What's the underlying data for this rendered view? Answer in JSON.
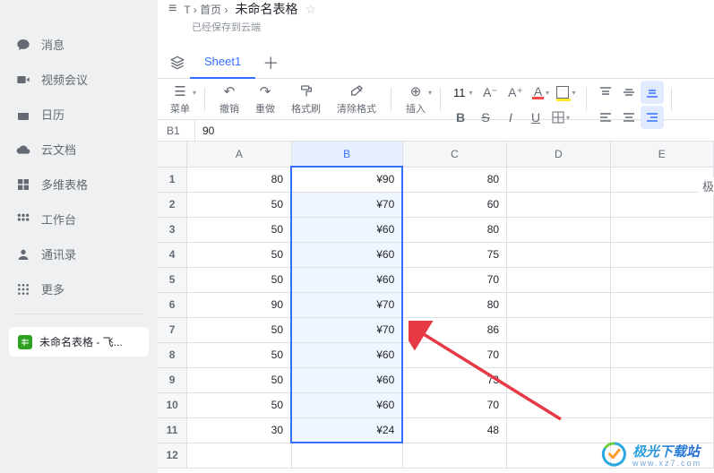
{
  "breadcrumb": {
    "path": "T › 首页 › ",
    "title": "未命名表格",
    "star": "☆"
  },
  "save_status": "已经保存到云端",
  "sheet_tab": "Sheet1",
  "nav": [
    {
      "icon": "chat",
      "label": "消息"
    },
    {
      "icon": "video",
      "label": "视频会议"
    },
    {
      "icon": "calendar",
      "label": "日历"
    },
    {
      "icon": "clouddoc",
      "label": "云文档"
    },
    {
      "icon": "multitable",
      "label": "多维表格"
    },
    {
      "icon": "workspace",
      "label": "工作台"
    },
    {
      "icon": "contacts",
      "label": "通讯录"
    },
    {
      "icon": "more",
      "label": "更多"
    }
  ],
  "doc_tab": "未命名表格 - 飞...",
  "toolbar": {
    "menu": {
      "icon": "☰",
      "label": "菜单"
    },
    "undo": {
      "icon": "↶",
      "label": "撤销"
    },
    "redo": {
      "icon": "↷",
      "label": "重做"
    },
    "format_painter": {
      "icon": "⌐",
      "label": "格式刷"
    },
    "clear_format": {
      "icon": "◇",
      "label": "清除格式"
    },
    "insert": {
      "icon": "⊕",
      "label": "插入"
    },
    "font_size": "11",
    "A": "A",
    "B": "B",
    "I": "I",
    "U": "U",
    "S": "S"
  },
  "cell_ref": "B1",
  "cell_val": "90",
  "columns": [
    "A",
    "B",
    "C",
    "D",
    "E"
  ],
  "rows": [
    {
      "n": "1",
      "A": "80",
      "B": "¥90",
      "C": "80"
    },
    {
      "n": "2",
      "A": "50",
      "B": "¥70",
      "C": "60"
    },
    {
      "n": "3",
      "A": "50",
      "B": "¥60",
      "C": "80"
    },
    {
      "n": "4",
      "A": "50",
      "B": "¥60",
      "C": "75"
    },
    {
      "n": "5",
      "A": "50",
      "B": "¥60",
      "C": "70"
    },
    {
      "n": "6",
      "A": "90",
      "B": "¥70",
      "C": "80"
    },
    {
      "n": "7",
      "A": "50",
      "B": "¥70",
      "C": "86"
    },
    {
      "n": "8",
      "A": "50",
      "B": "¥60",
      "C": "70"
    },
    {
      "n": "9",
      "A": "50",
      "B": "¥60",
      "C": "73"
    },
    {
      "n": "10",
      "A": "50",
      "B": "¥60",
      "C": "70"
    },
    {
      "n": "11",
      "A": "30",
      "B": "¥24",
      "C": "48"
    },
    {
      "n": "12",
      "A": "",
      "B": "",
      "C": ""
    }
  ],
  "side_label": "极",
  "watermark": {
    "brand": "极光下载站",
    "url": "www.xz7.com"
  }
}
